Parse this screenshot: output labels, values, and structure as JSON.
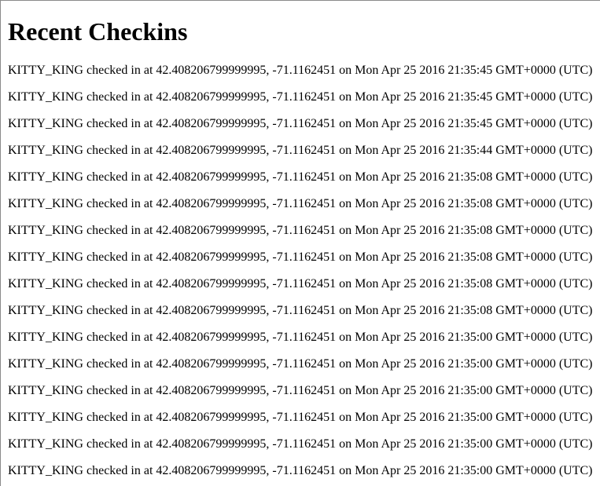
{
  "page": {
    "title": "Recent Checkins"
  },
  "checkins": [
    {
      "user": "KITTY_KING",
      "lat": "42.408206799999995",
      "lng": "-71.1162451",
      "time": "Mon Apr 25 2016 21:35:45 GMT+0000 (UTC)"
    },
    {
      "user": "KITTY_KING",
      "lat": "42.408206799999995",
      "lng": "-71.1162451",
      "time": "Mon Apr 25 2016 21:35:45 GMT+0000 (UTC)"
    },
    {
      "user": "KITTY_KING",
      "lat": "42.408206799999995",
      "lng": "-71.1162451",
      "time": "Mon Apr 25 2016 21:35:45 GMT+0000 (UTC)"
    },
    {
      "user": "KITTY_KING",
      "lat": "42.408206799999995",
      "lng": "-71.1162451",
      "time": "Mon Apr 25 2016 21:35:44 GMT+0000 (UTC)"
    },
    {
      "user": "KITTY_KING",
      "lat": "42.408206799999995",
      "lng": "-71.1162451",
      "time": "Mon Apr 25 2016 21:35:08 GMT+0000 (UTC)"
    },
    {
      "user": "KITTY_KING",
      "lat": "42.408206799999995",
      "lng": "-71.1162451",
      "time": "Mon Apr 25 2016 21:35:08 GMT+0000 (UTC)"
    },
    {
      "user": "KITTY_KING",
      "lat": "42.408206799999995",
      "lng": "-71.1162451",
      "time": "Mon Apr 25 2016 21:35:08 GMT+0000 (UTC)"
    },
    {
      "user": "KITTY_KING",
      "lat": "42.408206799999995",
      "lng": "-71.1162451",
      "time": "Mon Apr 25 2016 21:35:08 GMT+0000 (UTC)"
    },
    {
      "user": "KITTY_KING",
      "lat": "42.408206799999995",
      "lng": "-71.1162451",
      "time": "Mon Apr 25 2016 21:35:08 GMT+0000 (UTC)"
    },
    {
      "user": "KITTY_KING",
      "lat": "42.408206799999995",
      "lng": "-71.1162451",
      "time": "Mon Apr 25 2016 21:35:08 GMT+0000 (UTC)"
    },
    {
      "user": "KITTY_KING",
      "lat": "42.408206799999995",
      "lng": "-71.1162451",
      "time": "Mon Apr 25 2016 21:35:00 GMT+0000 (UTC)"
    },
    {
      "user": "KITTY_KING",
      "lat": "42.408206799999995",
      "lng": "-71.1162451",
      "time": "Mon Apr 25 2016 21:35:00 GMT+0000 (UTC)"
    },
    {
      "user": "KITTY_KING",
      "lat": "42.408206799999995",
      "lng": "-71.1162451",
      "time": "Mon Apr 25 2016 21:35:00 GMT+0000 (UTC)"
    },
    {
      "user": "KITTY_KING",
      "lat": "42.408206799999995",
      "lng": "-71.1162451",
      "time": "Mon Apr 25 2016 21:35:00 GMT+0000 (UTC)"
    },
    {
      "user": "KITTY_KING",
      "lat": "42.408206799999995",
      "lng": "-71.1162451",
      "time": "Mon Apr 25 2016 21:35:00 GMT+0000 (UTC)"
    },
    {
      "user": "KITTY_KING",
      "lat": "42.408206799999995",
      "lng": "-71.1162451",
      "time": "Mon Apr 25 2016 21:35:00 GMT+0000 (UTC)"
    }
  ],
  "phrases": {
    "checked_in_at": "checked in at",
    "separator": ",",
    "on": "on"
  }
}
